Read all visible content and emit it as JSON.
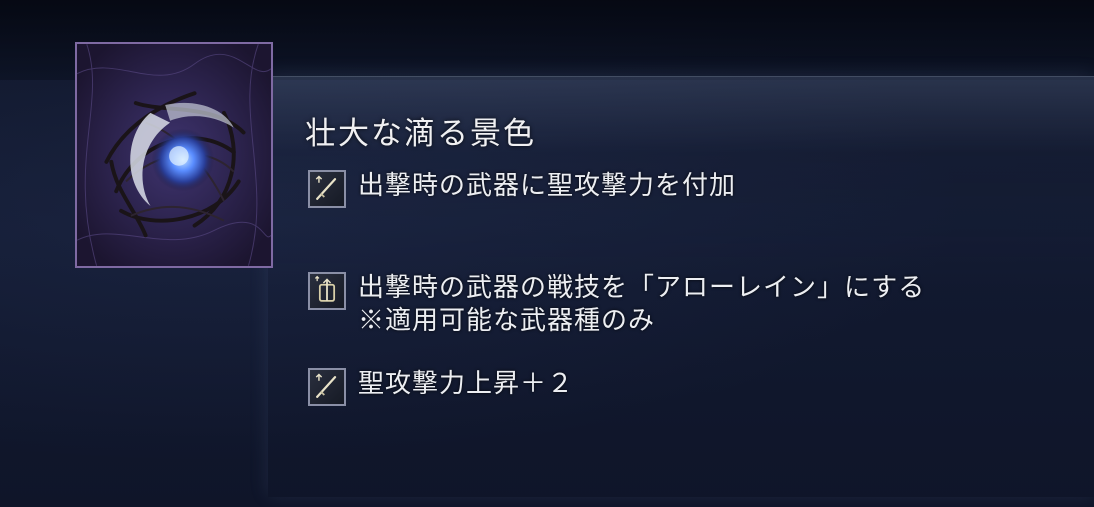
{
  "item": {
    "title": "壮大な滴る景色",
    "icon": "sacred-flask-orb-icon"
  },
  "effects": [
    {
      "icon": "sword-holy-icon",
      "lines": [
        "出撃時の武器に聖攻撃力を付加"
      ]
    },
    {
      "icon": "skill-arrow-icon",
      "lines": [
        "出撃時の武器の戦技を「アローレイン」にする",
        "※適用可能な武器種のみ"
      ]
    },
    {
      "icon": "sword-holy-icon",
      "lines": [
        "聖攻撃力上昇＋２"
      ]
    }
  ],
  "colors": {
    "icon_border": "#7f6aa3",
    "effect_icon_border": "#8a8fa6",
    "text": "#eceef2"
  }
}
